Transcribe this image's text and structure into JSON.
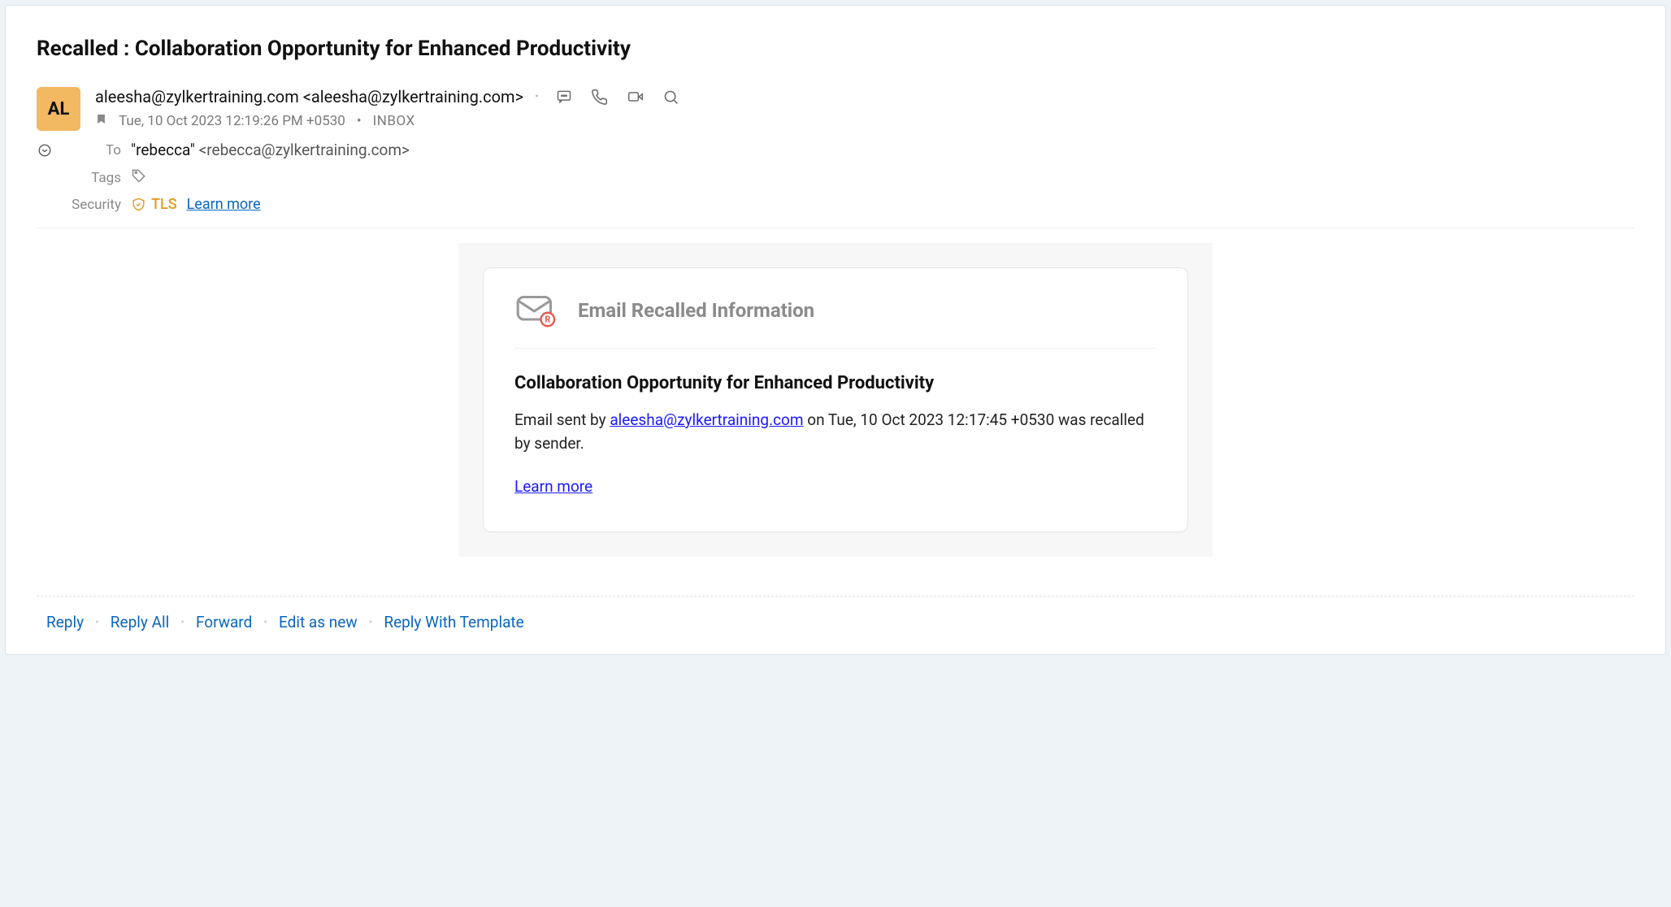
{
  "subject": "Recalled : Collaboration Opportunity for Enhanced Productivity",
  "avatar_initials": "AL",
  "from_display": "aleesha@zylkertraining.com <aleesha@zylkertraining.com>",
  "timestamp": "Tue, 10 Oct 2023 12:19:26 PM +0530",
  "folder": "INBOX",
  "labels": {
    "to": "To",
    "tags": "Tags",
    "security": "Security"
  },
  "to_name": "\"rebecca\"",
  "to_addr": " <rebecca@zylkertraining.com>",
  "security_tls": "TLS",
  "security_learn_more": "Learn more",
  "recall": {
    "header": "Email Recalled Information",
    "subject": "Collaboration Opportunity for Enhanced Productivity",
    "text_prefix": "Email sent by ",
    "sender_link": "aleesha@zylkertraining.com",
    "text_middle": " on Tue, 10 Oct 2023 12:17:45 +0530 was recalled by sender.",
    "learn_more": "Learn more"
  },
  "footer": {
    "reply": "Reply",
    "reply_all": "Reply All",
    "forward": "Forward",
    "edit_as_new": "Edit as new",
    "reply_with_template": "Reply With Template"
  }
}
